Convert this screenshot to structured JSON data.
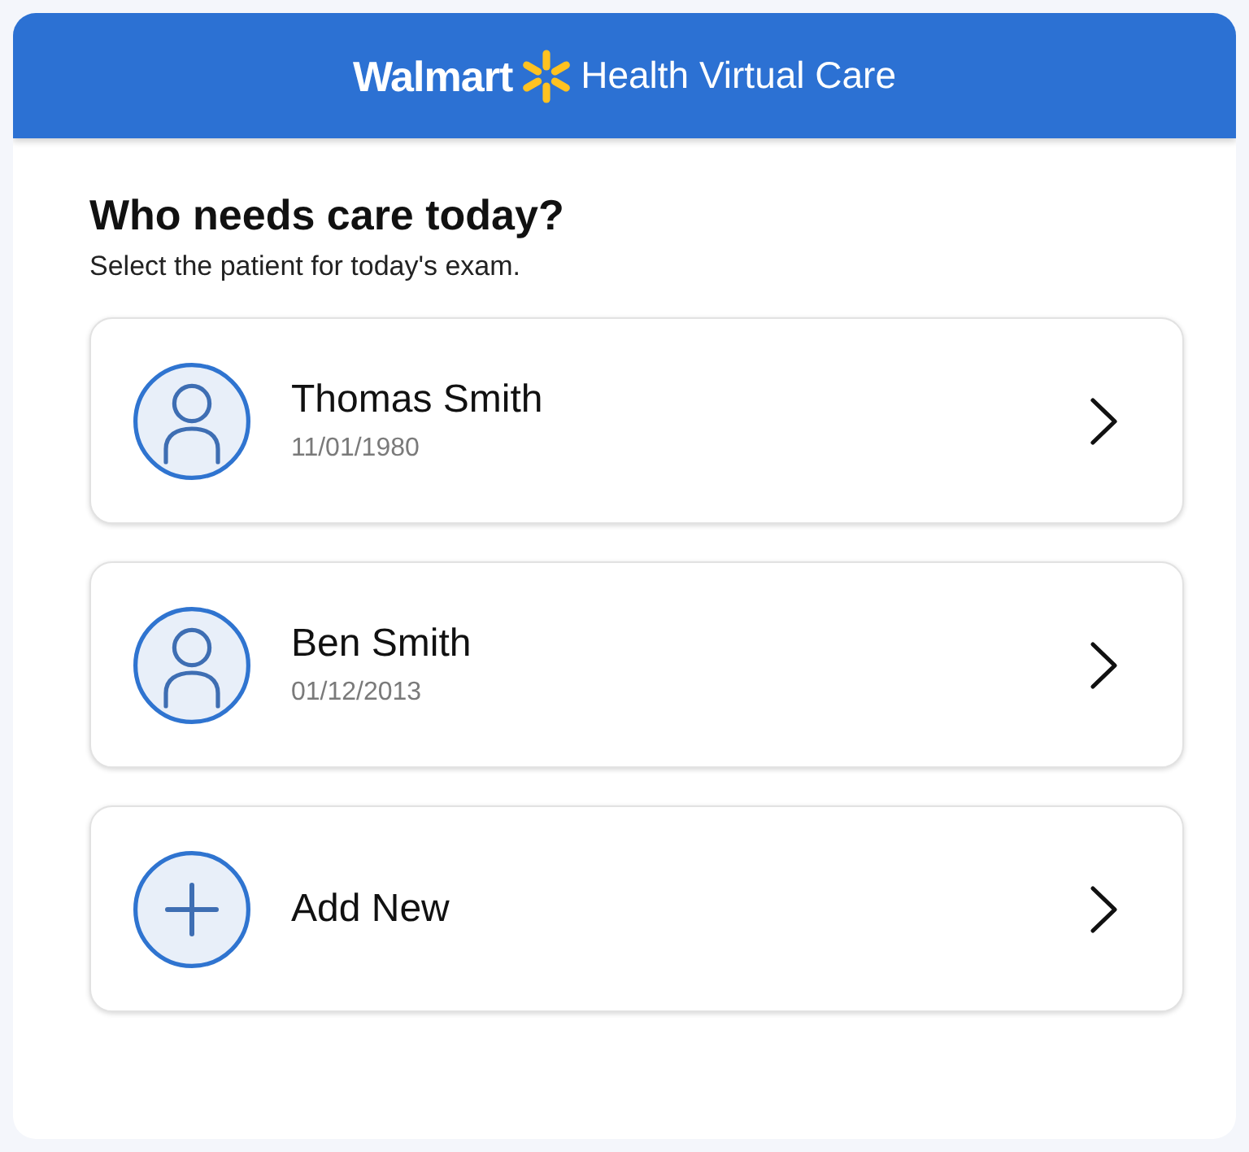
{
  "header": {
    "brand": "Walmart",
    "title": "Health Virtual Care"
  },
  "heading": "Who needs care today?",
  "subheading": "Select the patient for today's exam.",
  "patients": [
    {
      "kind": "person",
      "label": "Thomas Smith",
      "dob": "11/01/1980"
    },
    {
      "kind": "person",
      "label": "Ben Smith",
      "dob": "01/12/2013"
    },
    {
      "kind": "add",
      "label": "Add New"
    }
  ]
}
